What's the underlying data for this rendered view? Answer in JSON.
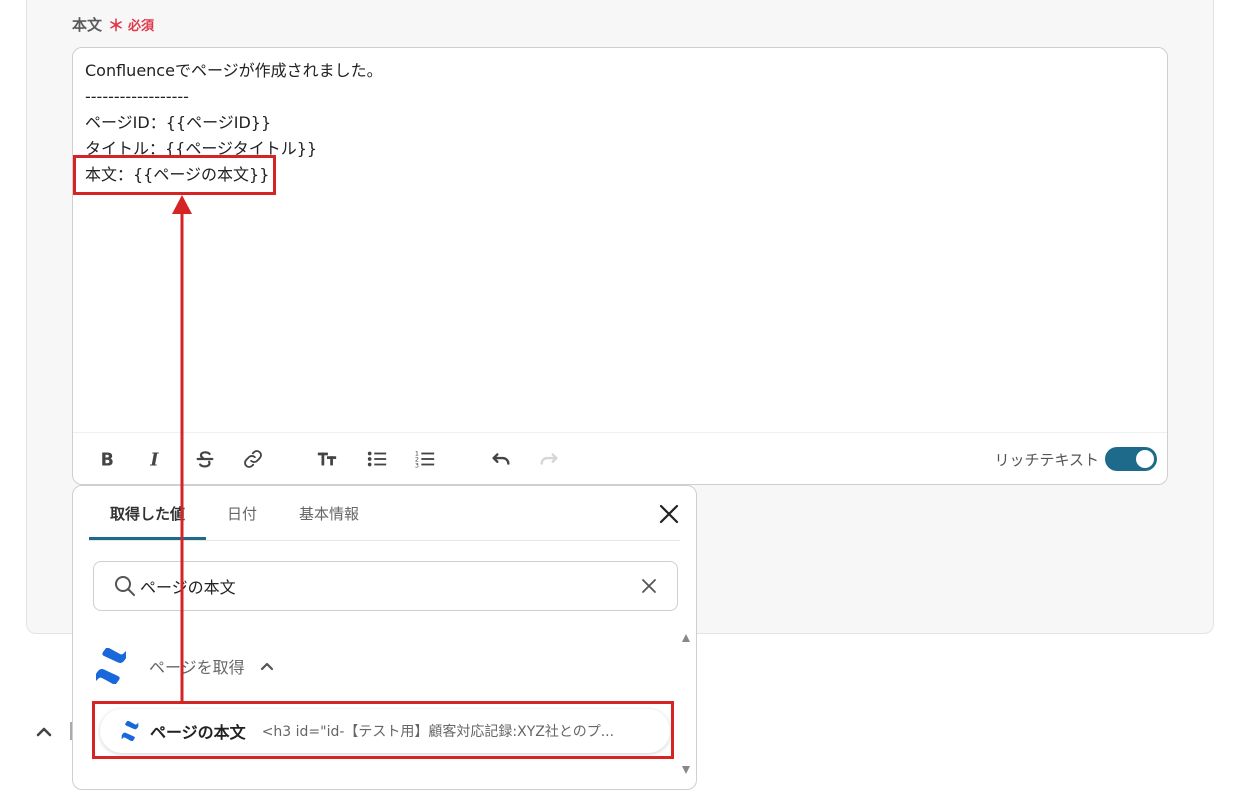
{
  "field": {
    "label": "本文",
    "asterisk": "＊",
    "required": "必須"
  },
  "editor": {
    "lines": [
      "Confluenceでページが作成されました。",
      "------------------",
      "ページID：{{ページID}}",
      "タイトル：{{ページタイトル}}",
      "本文：{{ページの本文}}"
    ],
    "toolbar": {
      "bold": "bold-icon",
      "italic": "italic-icon",
      "strike": "strikethrough-icon",
      "link": "link-icon",
      "text_size": "text-size-icon",
      "bullet_list": "bullet-list-icon",
      "numbered_list": "numbered-list-icon",
      "undo": "undo-icon",
      "redo": "redo-icon"
    },
    "rich_text_label": "リッチテキスト",
    "rich_text_enabled": true
  },
  "panel": {
    "tabs": [
      {
        "label": "取得した値",
        "active": true
      },
      {
        "label": "日付",
        "active": false
      },
      {
        "label": "基本情報",
        "active": false
      }
    ],
    "search": {
      "value": "ページの本文"
    },
    "group": {
      "name": "ページを取得",
      "expanded": true
    },
    "result": {
      "name": "ページの本文",
      "value": "<h3 id=\"id-【テスト用】顧客対応記録:XYZ社とのプ..."
    }
  },
  "colors": {
    "accent": "#1d6a8a",
    "required": "#e0394b",
    "highlight": "#d42424",
    "confluence_dark": "#1868db",
    "confluence_light": "#2684ff"
  }
}
